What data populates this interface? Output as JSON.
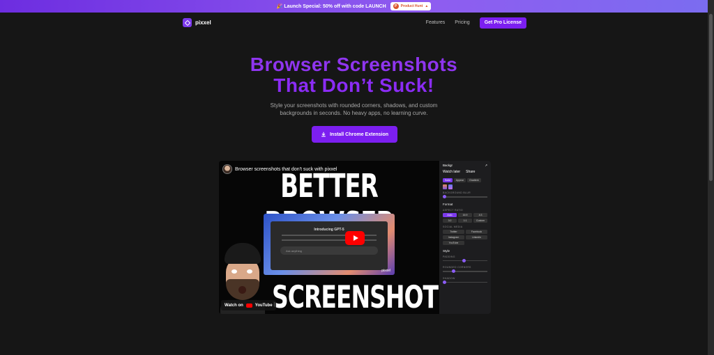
{
  "banner": {
    "text": "🎉 Launch Special: 50% off with code LAUNCH",
    "badge_small": "FEATURED ON",
    "badge_name": "Product Hunt",
    "badge_count": "▲"
  },
  "nav": {
    "brand": "pixxel",
    "links": [
      "Features",
      "Pricing"
    ],
    "cta": "Get Pro License"
  },
  "hero": {
    "title_line1": "Browser Screenshots",
    "title_line2": "That Don’t Suck!",
    "subtitle_line1": "Style your screenshots with rounded corners, shadows, and custom",
    "subtitle_line2": "backgrounds in seconds. No heavy apps, no learning curve.",
    "cta": "Install Chrome Extension"
  },
  "video": {
    "title": "Browser screenshots that don't suck with pixxel",
    "headline_top": "BETTER BROWSER",
    "headline_bottom": "SCREENSHOTS",
    "mock_title": "Introducing GPT-5",
    "mock_input": "Ask anything",
    "mock_tag": "pixxel",
    "watch_on": "Watch on",
    "youtube": "YouTube"
  },
  "panel": {
    "head_left": "Backgr",
    "watch_later": "Watch later",
    "share": "Share",
    "tabs": [
      "Solid",
      "Appear",
      "Gradient"
    ],
    "label_blur": "BACKGROUND BLUR",
    "format": "Format",
    "aspect_label": "ASPECT RATIO",
    "aspect_options": [
      "Auto",
      "16:9",
      "4:3",
      "3:2",
      "1:1",
      "Custom"
    ],
    "social_label": "SOCIAL MEDIA",
    "social_options": [
      "Twitter",
      "Facebook",
      "Instagram",
      "LinkedIn",
      "YouTube"
    ],
    "style": "Style",
    "padding": "PADDING",
    "radius": "ROUNDED CORNERS",
    "shadow": "SHADOW"
  },
  "colors": {
    "accent": "#7c1ff0",
    "title_purple": "#8f35ef",
    "background": "#161616"
  }
}
